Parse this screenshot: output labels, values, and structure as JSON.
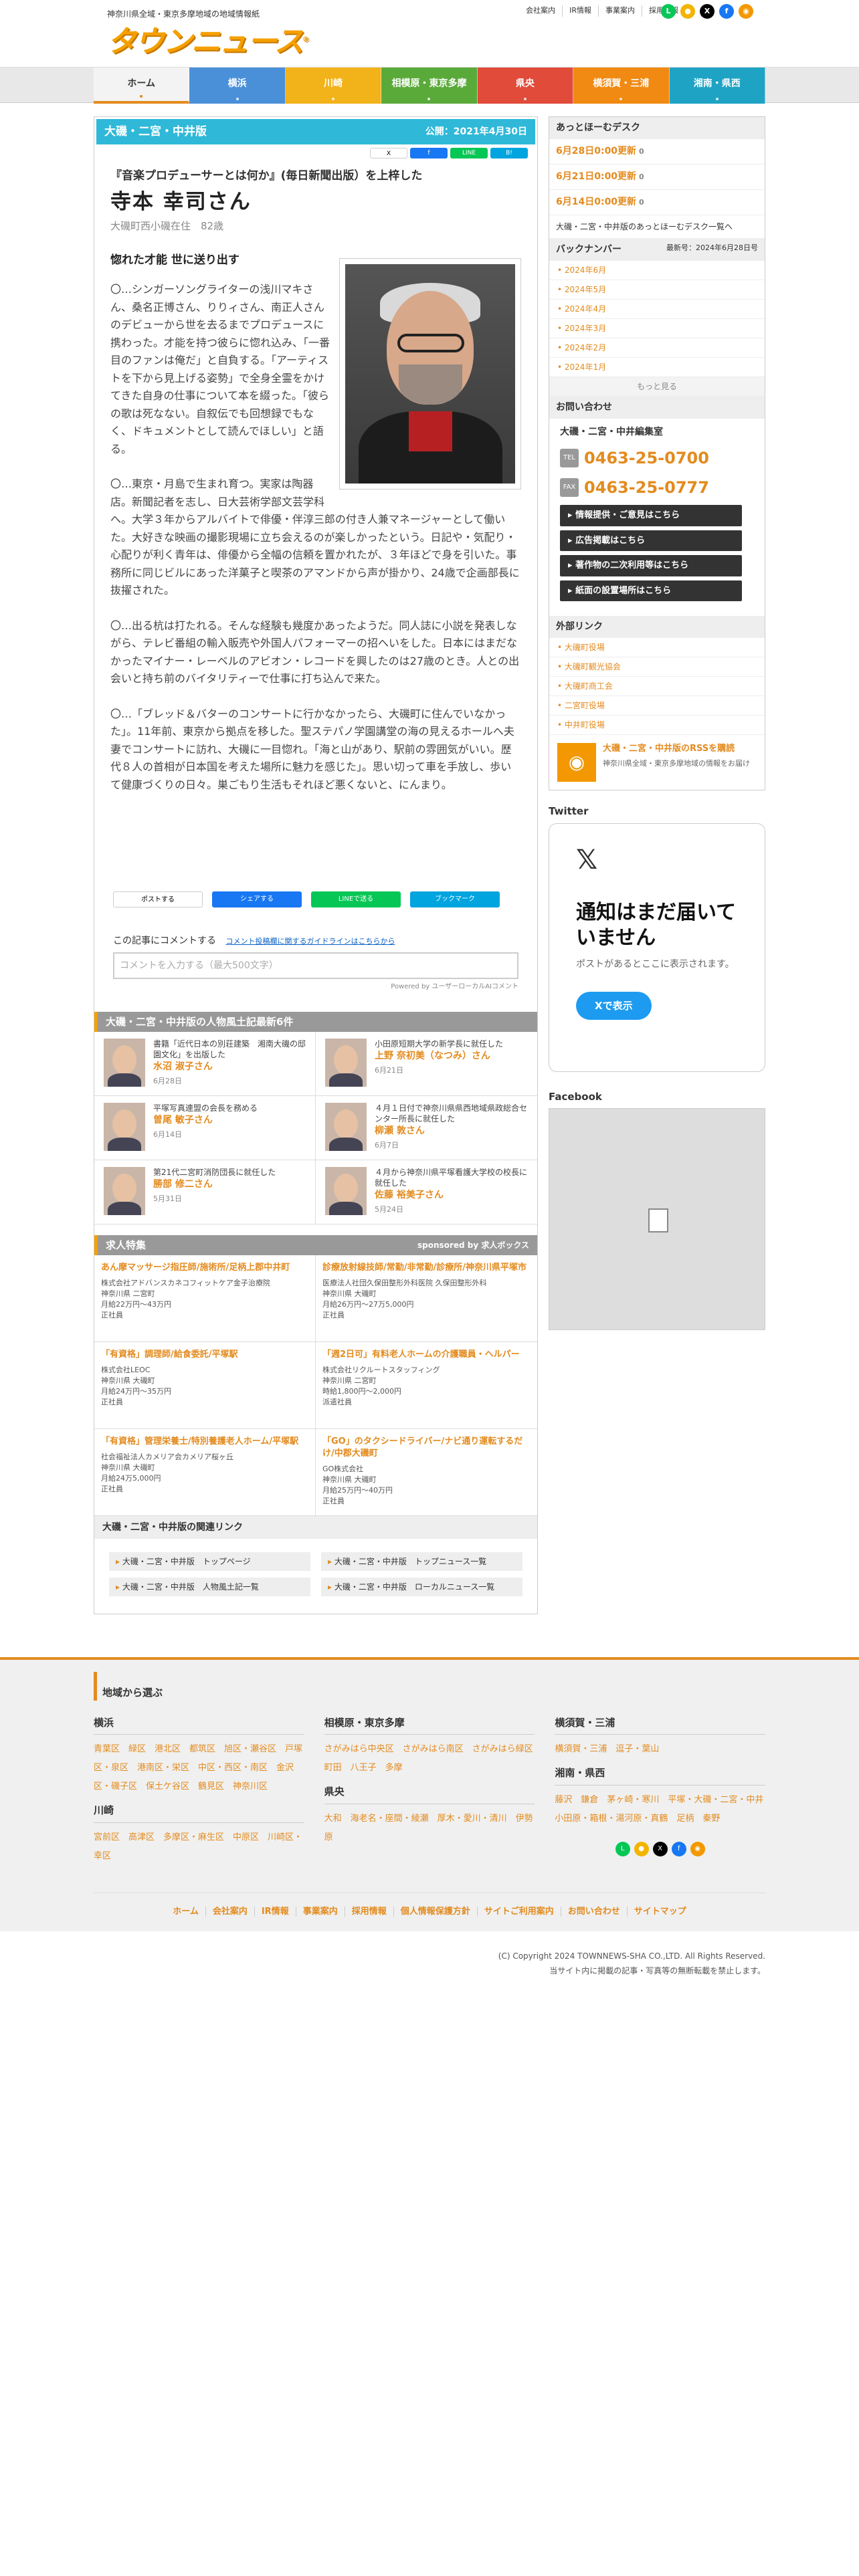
{
  "header": {
    "tagline": "神奈川県全域・東京多摩地域の地域情報紙",
    "logo": "タウンニュース",
    "logo_mark": "®",
    "top_links": [
      "会社案内",
      "IR情報",
      "事業案内",
      "採用情報"
    ]
  },
  "nav": [
    {
      "label": "ホーム",
      "color": "#f3f3f3"
    },
    {
      "label": "横浜",
      "color": "#4a90d9"
    },
    {
      "label": "川崎",
      "color": "#f2b21a"
    },
    {
      "label": "相模原・東京多摩",
      "color": "#5aaa3a"
    },
    {
      "label": "県央",
      "color": "#e04b3a"
    },
    {
      "label": "横須賀・三浦",
      "color": "#f08a12"
    },
    {
      "label": "湘南・県西",
      "color": "#1fa3c4"
    }
  ],
  "article": {
    "edition": "大磯・二宮・中井版",
    "published": "公開：2021年4月30日",
    "share_top": [
      "X",
      "f",
      "LINE",
      "B!"
    ],
    "subtitle": "『音楽プロデューサーとは何か』(毎日新聞出版）を上梓した",
    "name": "寺本 幸司さん",
    "location": "大磯町西小磯在住　82歳",
    "heading": "惚れた才能 世に送り出す",
    "paragraphs": [
      "〇…シンガーソングライターの浅川マキさん、桑名正博さん、りりィさん、南正人さんのデビューから世を去るまでプロデュースに携わった。才能を持つ彼らに惚れ込み、「一番目のファンは俺だ」と自負する。「アーティストを下から見上げる姿勢」で全身全霊をかけてきた自身の仕事について本を綴った。「彼らの歌は死なない。自叙伝でも回想録でもなく、ドキュメントとして読んでほしい」と語る。",
      "〇…東京・月島で生まれ育つ。実家は陶器店。新聞記者を志し、日大芸術学部文芸学科へ。大学３年からアルバイトで俳優・伴淳三郎の付き人兼マネージャーとして働いた。大好きな映画の撮影現場に立ち会えるのが楽しかったという。日記や・気配り・心配りが利く青年は、俳優から全幅の信頼を置かれたが、３年ほどで身を引いた。事務所に同じビルにあった洋菓子と喫茶のアマンドから声が掛かり、24歳で企画部長に抜擢された。",
      "〇…出る杭は打たれる。そんな経験も幾度かあったようだ。同人誌に小説を発表しながら、テレビ番組の輸入販売や外国人パフォーマーの招へいをした。日本にはまだなかったマイナー・レーベルのアビオン・レコードを興したのは27歳のとき。人との出会いと持ち前のバイタリティーで仕事に打ち込んで来た。",
      "〇…「ブレッド＆バターのコンサートに行かなかったら、大磯町に住んでいなかった」。11年前、東京から拠点を移した。聖ステパノ学園講堂の海の見えるホールへ夫妻でコンサートに訪れ、大磯に一目惚れ。「海と山があり、駅前の雰囲気がいい。歴代８人の首相が日本国を考えた場所に魅力を感じた」。思い切って車を手放し、歩いて健康づくりの日々。巣ごもり生活もそれほど悪くないと、にんまり。"
    ],
    "share_bottom": [
      "ポストする",
      "シェアする",
      "LINEで送る",
      "ブックマーク"
    ],
    "comment_label": "この記事にコメントする",
    "comment_guide": "コメント投稿欄に関するガイドラインはこちらから",
    "comment_placeholder": "コメントを入力する（最大500文字）",
    "powered": "Powered by ユーザーローカルAIコメント"
  },
  "people": {
    "heading": "大磯・二宮・中井版の人物風土記最新6件",
    "items": [
      {
        "desc": "書籍「近代日本の別荘建築　湘南大磯の邸園文化」を出版した",
        "name": "水沼 淑子さん",
        "date": "6月28日"
      },
      {
        "desc": "小田原短期大学の新学長に就任した",
        "name": "上野 奈初美（なつみ）さん",
        "date": "6月21日"
      },
      {
        "desc": "平塚写真連盟の会長を務める",
        "name": "曽尾 敏子さん",
        "date": "6月14日"
      },
      {
        "desc": "４月１日付で神奈川県県西地域県政総合センター所長に就任した",
        "name": "柳瀬 敦さん",
        "date": "6月7日"
      },
      {
        "desc": "第21代二宮町消防団長に就任した",
        "name": "勝部 修二さん",
        "date": "5月31日"
      },
      {
        "desc": "４月から神奈川県平塚看護大学校の校長に就任した",
        "name": "佐藤 裕美子さん",
        "date": "5月24日"
      }
    ]
  },
  "jobs": {
    "heading": "求人特集",
    "sponsor": "sponsored by 求人ボックス",
    "items": [
      {
        "title": "あん摩マッサージ指圧師/施術所/足柄上郡中井町",
        "company": "株式会社アドバンスカネコフィットケア金子治療院",
        "place": "神奈川県 二宮町",
        "pay": "月給22万円～43万円",
        "type": "正社員"
      },
      {
        "title": "診療放射線技師/常勤/非常勤/診療所/神奈川県平塚市",
        "company": "医療法人社団久保田整形外科医院 久保田整形外科",
        "place": "神奈川県 大磯町",
        "pay": "月給26万円～27万5,000円",
        "type": "正社員"
      },
      {
        "title": "「有資格」調理師/給食委託/平塚駅",
        "company": "株式会社LEOC",
        "place": "神奈川県 大磯町",
        "pay": "月給24万円～35万円",
        "type": "正社員"
      },
      {
        "title": "「週2日可」有料老人ホームの介護職員・ヘルパー",
        "company": "株式会社リクルートスタッフィング",
        "place": "神奈川県 二宮町",
        "pay": "時給1,800円～2,000円",
        "type": "派遣社員"
      },
      {
        "title": "「有資格」管理栄養士/特別養護老人ホーム/平塚駅",
        "company": "社会福祉法人カメリア会カメリア桜ヶ丘",
        "place": "神奈川県 大磯町",
        "pay": "月給24万5,000円",
        "type": "正社員"
      },
      {
        "title": "「GO」のタクシードライバー/ナビ通り運転するだけ/中郡大磯町",
        "company": "GO株式会社",
        "place": "神奈川県 大磯町",
        "pay": "月給25万円～40万円",
        "type": "正社員"
      }
    ]
  },
  "related": {
    "heading": "大磯・二宮・中井版の関連リンク",
    "links": [
      "大磯・二宮・中井版　トップページ",
      "大磯・二宮・中井版　トップニュース一覧",
      "大磯・二宮・中井版　人物風土記一覧",
      "大磯・二宮・中井版　ローカルニュース一覧"
    ]
  },
  "sidebar": {
    "desk_title": "あっとほーむデスク",
    "desk": [
      {
        "label": "6月28日0:00更新",
        "count": "0"
      },
      {
        "label": "6月21日0:00更新",
        "count": "0"
      },
      {
        "label": "6月14日0:00更新",
        "count": "0"
      }
    ],
    "desk_more": "大磯・二宮・中井版のあっとほーむデスク一覧へ",
    "backnumber": "バックナンバー",
    "latest": "最新号：2024年6月28日号",
    "months": [
      "2024年6月",
      "2024年5月",
      "2024年4月",
      "2024年3月",
      "2024年2月",
      "2024年1月"
    ],
    "months_more": "もっと見る",
    "contact_title": "お問い合わせ",
    "office": "大磯・二宮・中井編集室",
    "tel_label": "TEL",
    "tel": "0463-25-0700",
    "fax_label": "FAX",
    "fax": "0463-25-0777",
    "buttons": [
      "情報提供・ご意見はこちら",
      "広告掲載はこちら",
      "著作物の二次利用等はこちら",
      "紙面の設置場所はこちら"
    ],
    "ext_title": "外部リンク",
    "ext_links": [
      "大磯町役場",
      "大磯町観光協会",
      "大磯町商工会",
      "二宮町役場",
      "中井町役場"
    ],
    "rss_title": "大磯・二宮・中井版のRSSを購読",
    "rss_desc": "神奈川県全域・東京多摩地域の情報をお届け",
    "twitter": "Twitter",
    "tw_x": "𝕏",
    "tw_heading": "通知はまだ届いていません",
    "tw_text": "ポストがあるとここに表示されます。",
    "tw_button": "Xで表示",
    "facebook": "Facebook"
  },
  "footer": {
    "heading": "地域から選ぶ",
    "cols": [
      [
        {
          "title": "横浜",
          "areas": "青葉区　緑区　港北区　都筑区　旭区・瀬谷区　戸塚区・泉区　港南区・栄区　中区・西区・南区　金沢区・磯子区　保土ケ谷区　鶴見区　神奈川区"
        },
        {
          "title": "川崎",
          "areas": "宮前区　高津区　多摩区・麻生区　中原区　川崎区・幸区"
        }
      ],
      [
        {
          "title": "相模原・東京多摩",
          "areas": "さがみはら中央区　さがみはら南区　さがみはら緑区　町田　八王子　多摩"
        },
        {
          "title": "県央",
          "areas": "大和　海老名・座間・綾瀬　厚木・愛川・清川　伊勢原"
        }
      ],
      [
        {
          "title": "横須賀・三浦",
          "areas": "横須賀・三浦　逗子・葉山"
        },
        {
          "title": "湘南・県西",
          "areas": "藤沢　鎌倉　茅ヶ崎・寒川　平塚・大磯・二宮・中井　小田原・箱根・湯河原・真鶴　足柄　秦野"
        }
      ]
    ],
    "nav": [
      "ホーム",
      "会社案内",
      "IR情報",
      "事業案内",
      "採用情報",
      "個人情報保護方針",
      "サイトご利用案内",
      "お問い合わせ",
      "サイトマップ"
    ],
    "copyright": "(C) Copyright 2024 TOWNNEWS-SHA CO.,LTD. All Rights Reserved.",
    "notice": "当サイト内に掲載の記事・写真等の無断転載を禁止します。"
  }
}
